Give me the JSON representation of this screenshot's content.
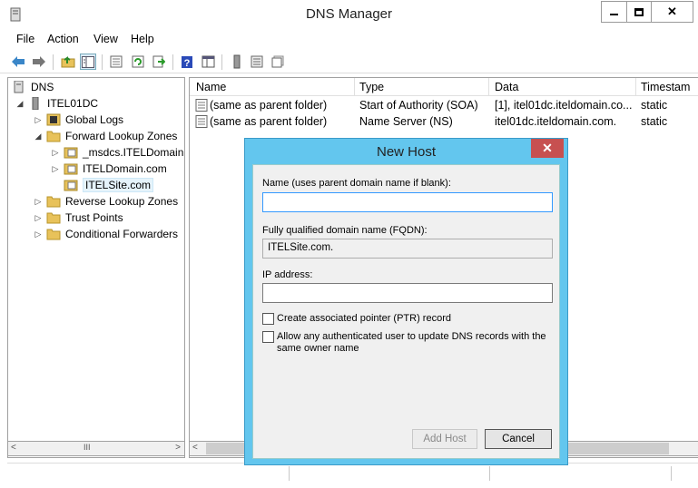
{
  "window": {
    "title": "DNS Manager",
    "controls": {
      "minimize": "–",
      "maximize": "□",
      "close": "✕"
    }
  },
  "menubar": [
    "File",
    "Action",
    "View",
    "Help"
  ],
  "toolbar": {
    "icons": [
      "back-arrow-icon",
      "forward-arrow-icon",
      "up-folder-icon",
      "show-hide-console-tree-icon",
      "properties-icon",
      "refresh-icon",
      "export-list-icon",
      "help-icon",
      "mmc-view-icon",
      "server-icon",
      "list-icon",
      "zone-icon"
    ]
  },
  "tree": {
    "root": "DNS",
    "server": "ITEL01DC",
    "items": [
      {
        "label": "Global Logs",
        "level": 2,
        "expander": "▷"
      },
      {
        "label": "Forward Lookup Zones",
        "level": 2,
        "expander": "◢"
      },
      {
        "label": "_msdcs.ITELDomain.c",
        "level": 3,
        "expander": "▷"
      },
      {
        "label": "ITELDomain.com",
        "level": 3,
        "expander": "▷"
      },
      {
        "label": "ITELSite.com",
        "level": 3,
        "expander": "",
        "selected": true
      },
      {
        "label": "Reverse Lookup Zones",
        "level": 2,
        "expander": "▷"
      },
      {
        "label": "Trust Points",
        "level": 2,
        "expander": "▷"
      },
      {
        "label": "Conditional Forwarders",
        "level": 2,
        "expander": "▷"
      }
    ],
    "scroll_thumb": "III"
  },
  "list": {
    "columns": [
      "Name",
      "Type",
      "Data",
      "Timestam"
    ],
    "rows": [
      [
        "(same as parent folder)",
        "Start of Authority (SOA)",
        "[1], itel01dc.iteldomain.co...",
        "static"
      ],
      [
        "(same as parent folder)",
        "Name Server (NS)",
        "itel01dc.iteldomain.com.",
        "static"
      ]
    ]
  },
  "dialog": {
    "title": "New Host",
    "close": "✕",
    "name_label": "Name (uses parent domain name if blank):",
    "name_value": "",
    "fqdn_label": "Fully qualified domain name (FQDN):",
    "fqdn_value": "ITELSite.com.",
    "ip_label": "IP address:",
    "ip_value": "",
    "ptr_label": "Create associated pointer (PTR) record",
    "auth_label_line1": "Allow any authenticated user to update DNS records with the",
    "auth_label_line2": "same owner name",
    "add_host": "Add Host",
    "cancel": "Cancel"
  },
  "colors": {
    "dialog_frame": "#63c6ee",
    "close_red": "#c75050",
    "folder_yellow": "#e8c25a"
  }
}
